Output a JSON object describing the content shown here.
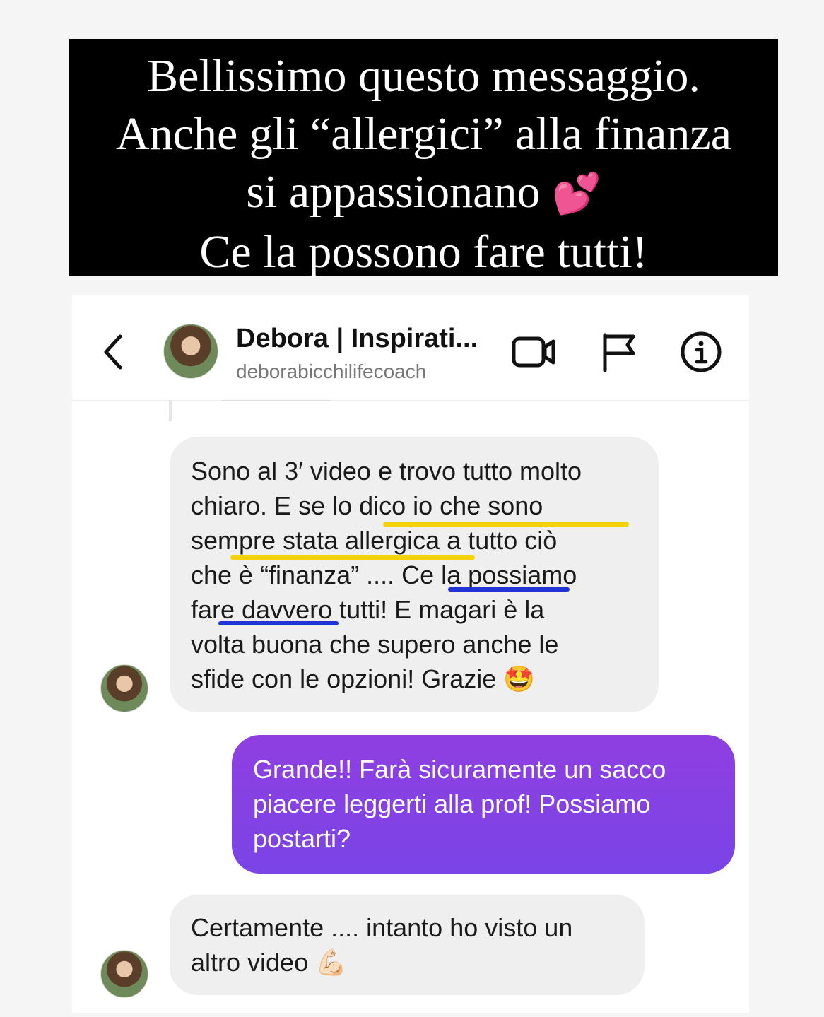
{
  "caption": {
    "lines": [
      "Bellissimo questo messaggio.",
      "Anche gli “allergici” alla finanza",
      "si appassionano",
      "Ce la possono fare tutti!"
    ],
    "emoji": "💕"
  },
  "header": {
    "name": "Debora | Inspirati...",
    "handle": "deborabicchilifecoach",
    "icons": [
      "back-chevron-icon",
      "video-call-icon",
      "flag-icon",
      "info-icon"
    ]
  },
  "messages": [
    {
      "direction": "incoming",
      "lines": [
        "Sono al 3′ video e trovo tutto molto",
        "chiaro. E se lo dico io che sono",
        "sempre stata allergica a tutto ciò",
        "che è “finanza” .... Ce la possiamo",
        "fare davvero tutti! E magari è la",
        "volta buona che supero anche le",
        "sfide con le opzioni! Grazie 🤩"
      ],
      "highlight_colors": [
        "#f5d20a",
        "#1f34d6"
      ]
    },
    {
      "direction": "outgoing",
      "lines": [
        "Grande!! Farà sicuramente un sacco",
        "piacere leggerti alla prof! Possiamo",
        "postarti?"
      ],
      "color": "#8f3fe0"
    },
    {
      "direction": "incoming",
      "lines": [
        "Certamente .... intanto ho visto un",
        "altro video 💪🏻"
      ]
    }
  ]
}
